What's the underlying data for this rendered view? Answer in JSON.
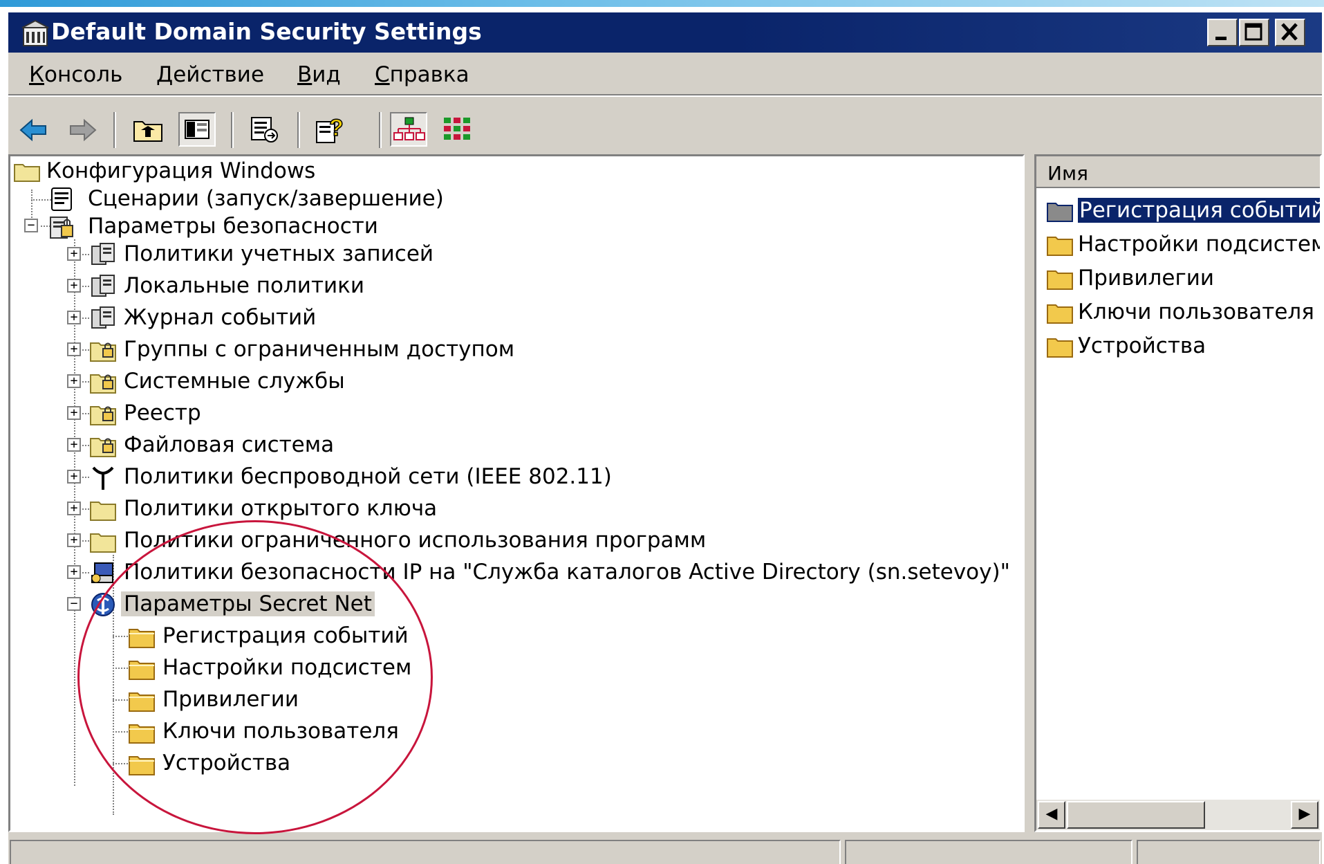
{
  "window": {
    "title": "Default Domain Security Settings"
  },
  "menu": {
    "items": [
      {
        "accel": "К",
        "rest": "онсоль"
      },
      {
        "accel": "Д",
        "rest": "ействие"
      },
      {
        "accel": "В",
        "rest": "ид"
      },
      {
        "accel": "С",
        "rest": "правка"
      }
    ]
  },
  "toolbar": {
    "buttons": [
      "back-arrow-icon",
      "forward-arrow-icon",
      "up-folder-icon",
      "show-hide-tree-icon",
      "export-list-icon",
      "help-icon",
      "tree-view-icon",
      "grid-view-icon"
    ]
  },
  "tree": {
    "root": "Конфигурация Windows",
    "scripts": "Сценарии (запуск/завершение)",
    "security": "Параметры безопасности",
    "children": [
      "Политики учетных записей",
      "Локальные политики",
      "Журнал событий",
      "Группы с ограниченным доступом",
      "Системные службы",
      "Реестр",
      "Файловая система",
      "Политики беспроводной сети (IEEE 802.11)",
      "Политики открытого ключа",
      "Политики ограниченного использования программ",
      "Политики безопасности IP на \"Служба каталогов Active Directory (sn.setevoy)\""
    ],
    "secret_net": "Параметры Secret Net",
    "secret_net_children": [
      "Регистрация событий",
      "Настройки подсистем",
      "Привилегии",
      "Ключи пользователя",
      "Устройства"
    ]
  },
  "list": {
    "column_header": "Имя",
    "items": [
      "Регистрация событий",
      "Настройки подсистем",
      "Привилегии",
      "Ключи пользователя",
      "Устройства"
    ]
  },
  "colors": {
    "titlebar": "#0a246a",
    "highlight_ellipse": "#c8153c",
    "folder": "#f2c94c"
  }
}
